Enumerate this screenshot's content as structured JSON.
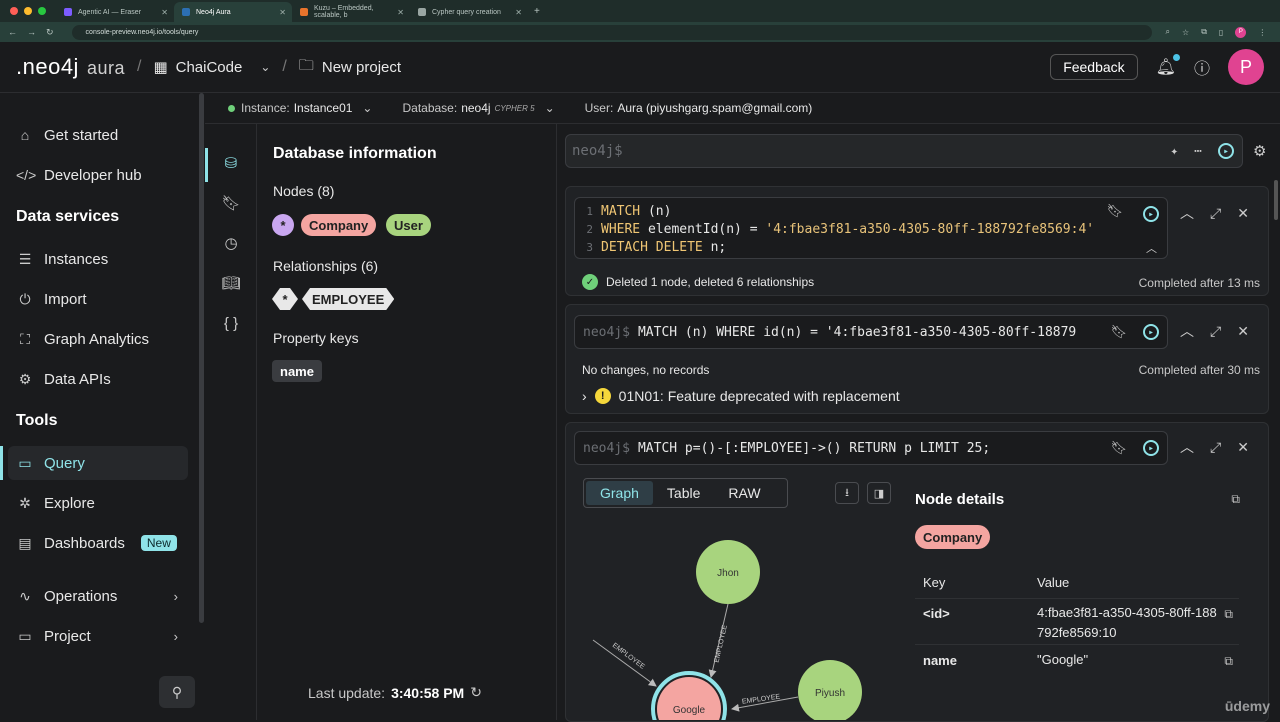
{
  "browser": {
    "tabs": [
      {
        "title": "Agentic AI — Eraser",
        "fav": "#7c5cff"
      },
      {
        "title": "Neo4j Aura",
        "fav": "#2c6fb3"
      },
      {
        "title": "Kuzu – Embedded, scalable, b",
        "fav": "#e8742c"
      },
      {
        "title": "Cypher query creation",
        "fav": "#9aa6a3"
      }
    ],
    "url": "console-preview.neo4j.io/tools/query",
    "profile_initial": "P"
  },
  "header": {
    "logo": ".neo4j",
    "logo_sub": "aura",
    "org": "ChaiCode",
    "project": "New project",
    "feedback": "Feedback",
    "avatar": "P"
  },
  "sidebar": {
    "items_top": [
      "Get started",
      "Developer hub"
    ],
    "data_services_heading": "Data services",
    "data_services": [
      "Instances",
      "Import",
      "Graph Analytics",
      "Data APIs"
    ],
    "tools_heading": "Tools",
    "tools": [
      "Query",
      "Explore",
      "Dashboards"
    ],
    "new_badge": "New",
    "bottom": [
      "Operations",
      "Project"
    ]
  },
  "instance_bar": {
    "instance_label": "Instance:",
    "instance_value": "Instance01",
    "database_label": "Database:",
    "database_value": "neo4j",
    "cypher_version": "CYPHER 5",
    "user_label": "User:",
    "user_value": "Aura (piyushgarg.spam@gmail.com)"
  },
  "db_info": {
    "title": "Database information",
    "nodes_label": "Nodes (8)",
    "node_chips": [
      "*",
      "Company",
      "User"
    ],
    "relationships_label": "Relationships (6)",
    "rel_chips": [
      "*",
      "EMPLOYEE"
    ],
    "property_keys_label": "Property keys",
    "property_keys": [
      "name"
    ],
    "last_update_label": "Last update:",
    "last_update_value": "3:40:58 PM"
  },
  "editor": {
    "placeholder": "neo4j$"
  },
  "cards": [
    {
      "lines": [
        {
          "num": "1",
          "kw": "MATCH",
          "rest": " (n)"
        },
        {
          "num": "2",
          "kw": "WHERE",
          "rest": " elementId(n) = ",
          "str": "'4:fbae3f81-a350-4305-80ff-188792fe8569:4'"
        },
        {
          "num": "3",
          "kw": "DETACH DELETE",
          "rest": " n;"
        }
      ],
      "status": "Deleted 1 node, deleted 6 relationships",
      "completed": "Completed after 13 ms"
    },
    {
      "prompt": "neo4j$",
      "query": "MATCH (n) WHERE id(n) = '4:fbae3f81-a350-4305-80ff-18879",
      "status": "No changes, no records",
      "completed": "Completed after 30 ms",
      "warning": "01N01: Feature deprecated with replacement"
    },
    {
      "prompt": "neo4j$",
      "query": "MATCH p=()-[:EMPLOYEE]->() RETURN p LIMIT 25;",
      "tabs": [
        "Graph",
        "Table",
        "RAW"
      ],
      "graph_nodes": [
        "Jhon",
        "Piyush",
        "Google"
      ],
      "rel_label": "EMPLOYEE"
    }
  ],
  "node_details": {
    "title": "Node details",
    "label_chip": "Company",
    "key_header": "Key",
    "value_header": "Value",
    "rows": [
      {
        "key": "<id>",
        "value": "4:fbae3f81-a350-4305-80ff-188792fe8569:10"
      },
      {
        "key": "name",
        "value": "\"Google\""
      }
    ]
  },
  "watermark": "ūdemy",
  "colors": {
    "accent": "#8fe3e8",
    "company": "#f4a5a1",
    "user": "#a8d47e",
    "star": "#c9a7f0"
  }
}
